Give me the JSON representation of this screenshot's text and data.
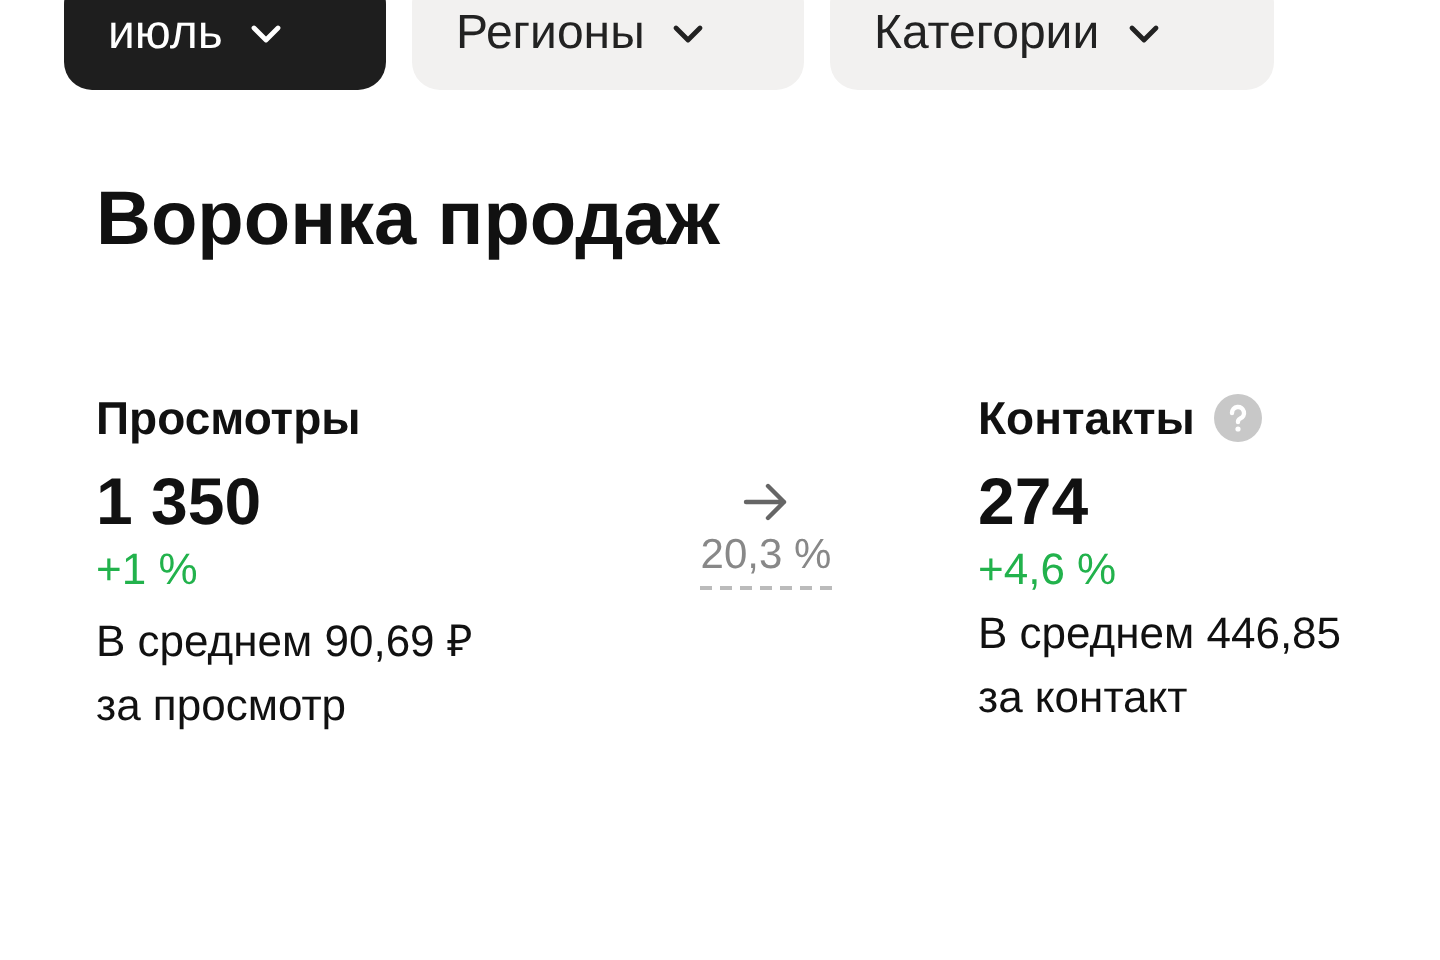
{
  "filters": [
    {
      "label": "июль",
      "selected": true
    },
    {
      "label": "Регионы",
      "selected": false
    },
    {
      "label": "Категории",
      "selected": false
    }
  ],
  "title": "Воронка продаж",
  "steps": [
    {
      "name": "Просмотры",
      "help": false,
      "value": "1 350",
      "change": "+1 %",
      "average": "В среднем 90,69 ₽",
      "unit": "за просмотр"
    },
    {
      "name": "Контакты",
      "help": true,
      "value": "274",
      "change": "+4,6 %",
      "average": "В среднем 446,85",
      "unit": "за контакт"
    }
  ],
  "conversions": [
    "20,3 %"
  ]
}
